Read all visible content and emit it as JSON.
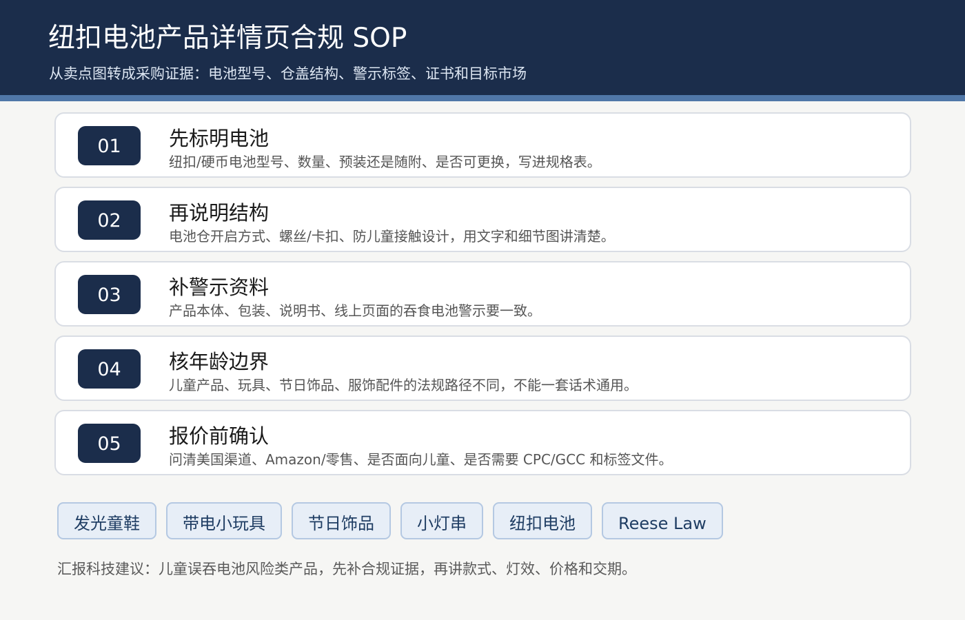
{
  "header": {
    "title": "纽扣电池产品详情页合规 SOP",
    "subtitle": "从卖点图转成采购证据：电池型号、仓盖结构、警示标签、证书和目标市场"
  },
  "steps": [
    {
      "number": "01",
      "title": "先标明电池",
      "desc": "纽扣/硬币电池型号、数量、预装还是随附、是否可更换，写进规格表。"
    },
    {
      "number": "02",
      "title": "再说明结构",
      "desc": "电池仓开启方式、螺丝/卡扣、防儿童接触设计，用文字和细节图讲清楚。"
    },
    {
      "number": "03",
      "title": "补警示资料",
      "desc": "产品本体、包装、说明书、线上页面的吞食电池警示要一致。"
    },
    {
      "number": "04",
      "title": "核年龄边界",
      "desc": "儿童产品、玩具、节日饰品、服饰配件的法规路径不同，不能一套话术通用。"
    },
    {
      "number": "05",
      "title": "报价前确认",
      "desc": "问清美国渠道、Amazon/零售、是否面向儿童、是否需要 CPC/GCC 和标签文件。"
    }
  ],
  "tags": [
    "发光童鞋",
    "带电小玩具",
    "节日饰品",
    "小灯串",
    "纽扣电池",
    "Reese Law"
  ],
  "footer": {
    "note": "汇报科技建议：儿童误吞电池风险类产品，先补合规证据，再讲款式、灯效、价格和交期。"
  },
  "colors": {
    "header_bg": "#1b2d4b",
    "header_stripe": "#5077a8",
    "tag_bg": "#e7eef7",
    "tag_border": "#b4c8e2"
  }
}
